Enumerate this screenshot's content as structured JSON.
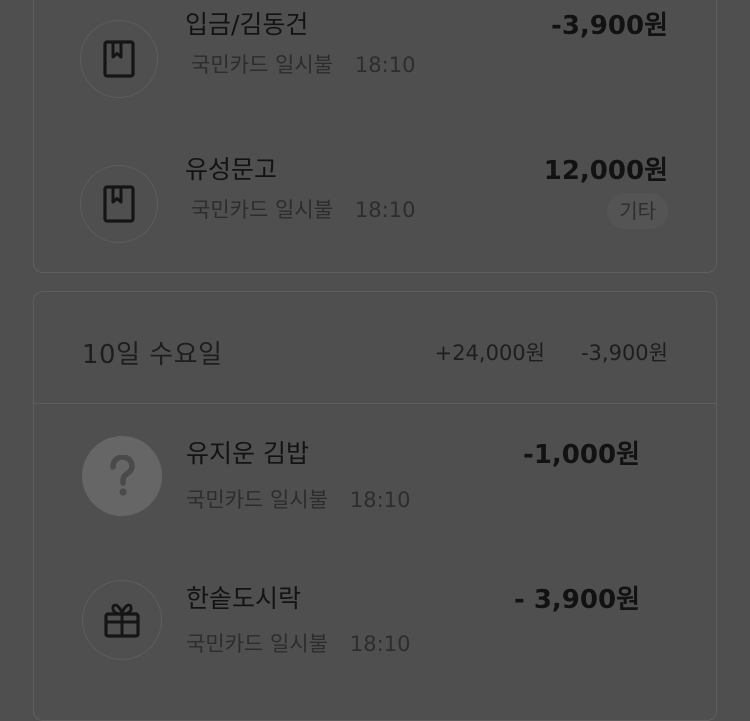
{
  "colors": {
    "background": "#4f4f4f",
    "card_border": "#5e5e5e",
    "text_primary": "#131313",
    "text_secondary": "#2d2d2d"
  },
  "groups": [
    {
      "transactions": [
        {
          "name": "입금/김동건",
          "payment": "국민카드 일시불",
          "time": "18:10",
          "amount": "-3,900원",
          "icon": "bookmark-book-icon"
        },
        {
          "name": "유성문고",
          "payment": "국민카드 일시불",
          "time": "18:10",
          "amount": "12,000원",
          "tag": "기타",
          "icon": "bookmark-book-icon"
        }
      ]
    },
    {
      "day": "10일 수요일",
      "income": "+24,000원",
      "expense": "-3,900원",
      "transactions": [
        {
          "name": "유지운 김밥",
          "payment": "국민카드 일시불",
          "time": "18:10",
          "amount": "-1,000원",
          "icon": "question-mark-icon"
        },
        {
          "name": "한솥도시락",
          "payment": "국민카드 일시불",
          "time": "18:10",
          "amount": "- 3,900원",
          "icon": "gift-icon"
        }
      ]
    }
  ]
}
